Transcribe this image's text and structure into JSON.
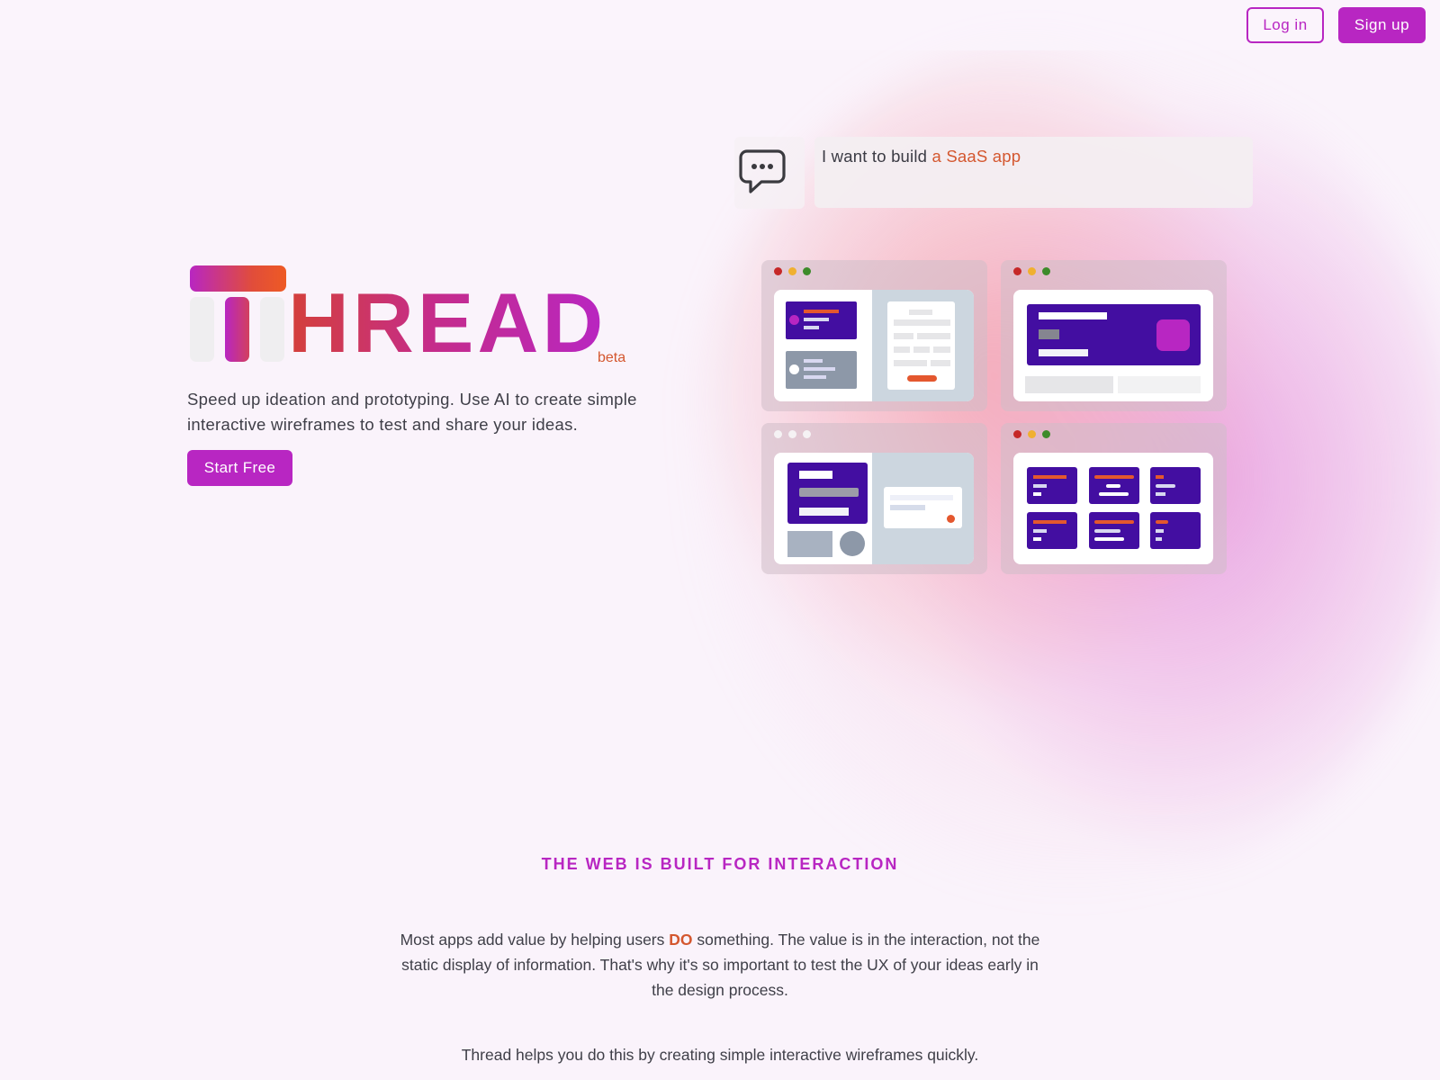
{
  "header": {
    "login_label": "Log in",
    "signup_label": "Sign up"
  },
  "hero": {
    "logo_text": "HREAD",
    "logo_alt": "THREAD",
    "beta_label": "beta",
    "tagline": "Speed up ideation and prototyping. Use AI to create simple interactive wireframes to test and share your ideas.",
    "cta_label": "Start Free"
  },
  "prompt": {
    "icon": "chat-bubble-icon",
    "text_prefix": "I want to build ",
    "text_highlight": "a SaaS app"
  },
  "previews": [
    {
      "name": "preview-split-form",
      "dots": "traffic-light"
    },
    {
      "name": "preview-hero-banner",
      "dots": "traffic-light"
    },
    {
      "name": "preview-detail-modal",
      "dots": "plain"
    },
    {
      "name": "preview-card-grid",
      "dots": "traffic-light"
    }
  ],
  "section": {
    "heading": "THE WEB IS BUILT FOR INTERACTION",
    "para1_before": "Most apps add value by helping users ",
    "para1_emphasis": "DO",
    "para1_after": " something. The value is in the interaction, not the static display of information. That's why it's so important to test the UX of your ideas early in the design process.",
    "para2": "Thread helps you do this by creating simple interactive wireframes quickly."
  },
  "colors": {
    "brand": "#b826c2",
    "accent": "#d4572f",
    "wire_purple": "#430ea1",
    "background": "#faf3fb"
  }
}
